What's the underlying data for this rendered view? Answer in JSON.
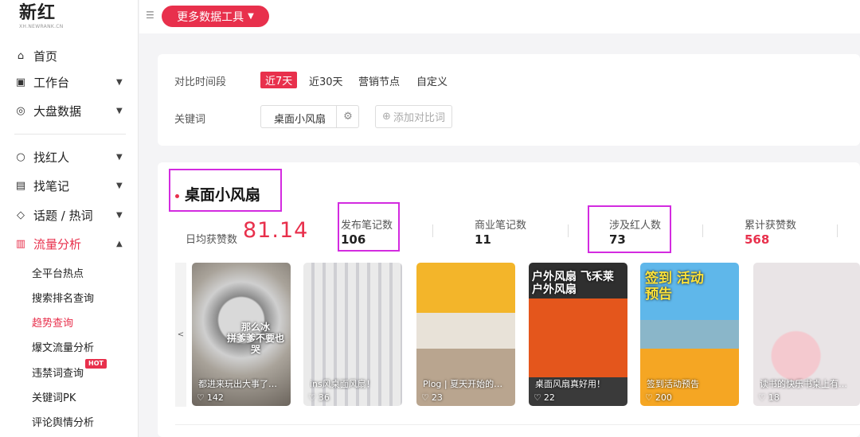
{
  "logo": {
    "main": "新红",
    "sub": "XH.NEWRANK.CN"
  },
  "sidebar": {
    "items": [
      {
        "label": "首页",
        "icon": "home-icon"
      },
      {
        "label": "工作台",
        "icon": "workbench-icon"
      },
      {
        "label": "大盘数据",
        "icon": "dashboard-icon"
      },
      {
        "label": "找红人",
        "icon": "search-person-icon"
      },
      {
        "label": "找笔记",
        "icon": "note-icon"
      },
      {
        "label": "话题 / 热词",
        "icon": "topic-icon"
      },
      {
        "label": "流量分析",
        "icon": "traffic-icon"
      }
    ],
    "subitems": [
      "全平台热点",
      "搜索排名查询",
      "趋势查询",
      "爆文流量分析",
      "违禁词查询",
      "关键词PK",
      "评论舆情分析"
    ],
    "hot_badge": "HOT"
  },
  "topbar": {
    "tools_button": "更多数据工具"
  },
  "filters": {
    "period_label": "对比时间段",
    "periods": [
      "近7天",
      "近30天",
      "营销节点",
      "自定义"
    ],
    "keyword_label": "关键词",
    "keyword": "桌面小风扇",
    "add_compare": "添加对比词"
  },
  "keyword_card": {
    "title": "桌面小风扇",
    "avg_likes_label": "日均获赞数",
    "avg_likes_value": "81.14",
    "stats": [
      {
        "label": "发布笔记数",
        "value": "106"
      },
      {
        "label": "商业笔记数",
        "value": "11"
      },
      {
        "label": "涉及红人数",
        "value": "73"
      },
      {
        "label": "累计获赞数",
        "value": "568"
      }
    ]
  },
  "notes": [
    {
      "caption": "都进来玩出大事了…",
      "likes": "142",
      "overlay": "那么冰\n拼爹爹不要也哭"
    },
    {
      "caption": "ins风桌面风扇！",
      "likes": "36",
      "overlay": ""
    },
    {
      "caption": "Plog | 夏天开始的…",
      "likes": "23",
      "overlay": ""
    },
    {
      "caption": "桌面风扇真好用！",
      "likes": "22",
      "overlay": "户外风扇 飞禾莱户外风扇"
    },
    {
      "caption": "签到活动预告",
      "likes": "200",
      "overlay": "签到 活动预告"
    },
    {
      "caption": "读书的快乐书桌上有…",
      "likes": "18",
      "overlay": ""
    }
  ],
  "colors": {
    "accent": "#e8304c",
    "highlight": "#d32be0"
  }
}
